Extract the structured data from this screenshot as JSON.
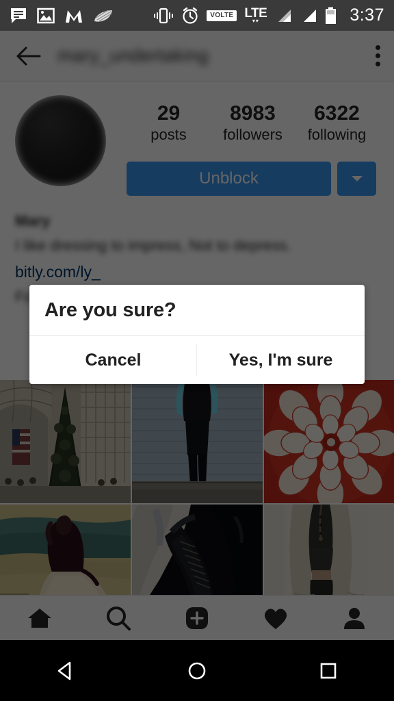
{
  "status_bar": {
    "time": "3:37",
    "left_icons": [
      "message-icon",
      "photo-icon",
      "m-logo-icon",
      "feather-icon"
    ],
    "right_icons": [
      "vibrate-icon",
      "alarm-icon",
      "volte-badge",
      "lte-icon",
      "signal-1-icon",
      "signal-2-icon",
      "battery-icon"
    ],
    "volte_label": "VOLTE",
    "lte_label": "LTE",
    "background_color": "#3a3a3a"
  },
  "app_header": {
    "back_icon": "back-arrow-icon",
    "title": "mary_undertaking",
    "overflow_icon": "overflow-menu-icon",
    "background_color": "#fafafa"
  },
  "profile": {
    "avatar": "profile-avatar",
    "stats": [
      {
        "value": "29",
        "label": "posts"
      },
      {
        "value": "8983",
        "label": "followers"
      },
      {
        "value": "6322",
        "label": "following"
      }
    ],
    "unblock_label": "Unblock",
    "dropdown_icon": "chevron-down-icon",
    "button_color": "#3897f0",
    "bio_name": "Mary",
    "bio_text": "I like dressing to impress, Not to depress.",
    "bio_link": "bitly.com/ly_",
    "bio_link_color": "#003569",
    "bio_extra": "Fo"
  },
  "photo_grid": {
    "cells": [
      {
        "name": "photo-christmas-tree"
      },
      {
        "name": "photo-person-blue-wall"
      },
      {
        "name": "photo-red-dahlia-flower"
      },
      {
        "name": "photo-beach-woman"
      },
      {
        "name": "photo-dark-boots"
      },
      {
        "name": "photo-person-cardigan"
      }
    ]
  },
  "dialog": {
    "title": "Are you sure?",
    "cancel_label": "Cancel",
    "confirm_label": "Yes, I'm sure"
  },
  "tab_bar": {
    "items": [
      {
        "name": "tab-home",
        "icon": "home-icon",
        "active": false
      },
      {
        "name": "tab-search",
        "icon": "search-icon",
        "active": true
      },
      {
        "name": "tab-add",
        "icon": "plus-square-icon",
        "active": false
      },
      {
        "name": "tab-activity",
        "icon": "heart-icon",
        "active": false
      },
      {
        "name": "tab-profile",
        "icon": "person-icon",
        "active": false
      }
    ]
  },
  "android_nav": {
    "back": "android-back-icon",
    "home": "android-home-icon",
    "recents": "android-recents-icon"
  }
}
